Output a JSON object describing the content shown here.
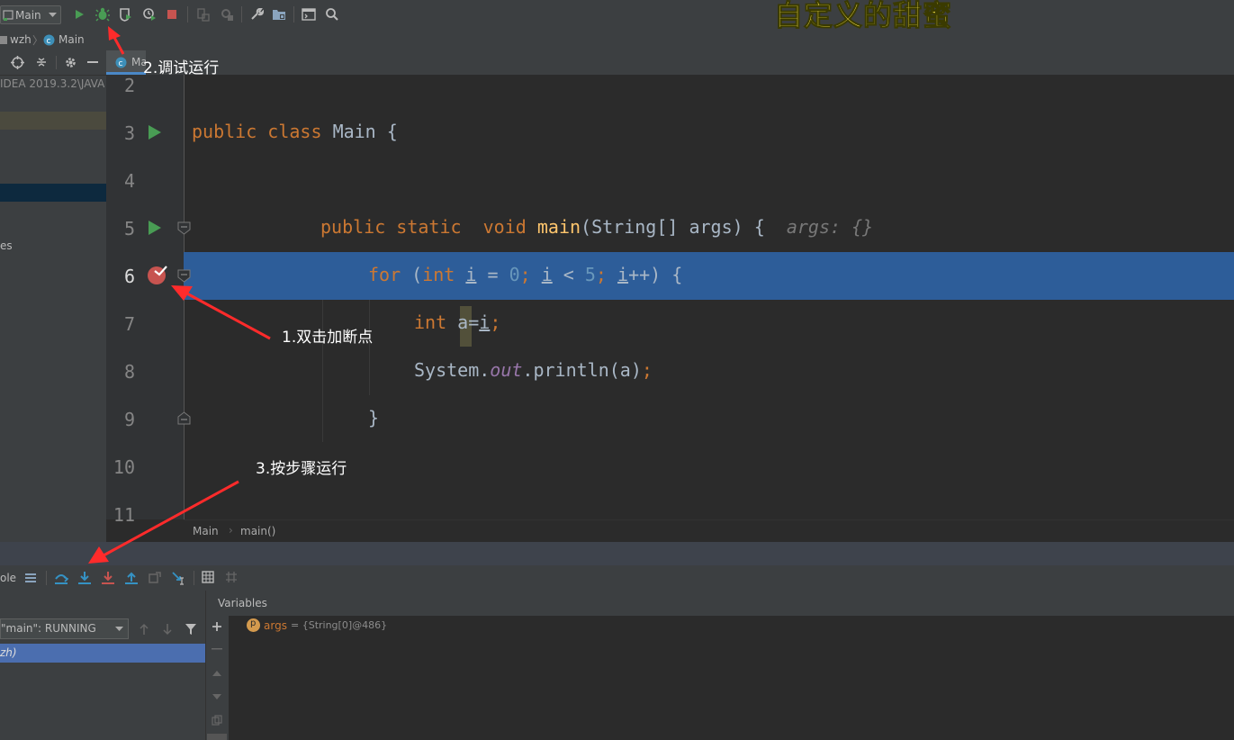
{
  "toolbar": {
    "run_config": "Main",
    "icons": [
      "run-icon",
      "debug-icon",
      "coverage-icon",
      "profile-icon",
      "stop-icon",
      "build-icon",
      "rebuild-icon",
      "settings-wrench-icon",
      "project-structure-icon",
      "terminal-icon",
      "search-icon"
    ]
  },
  "breadcrumb": {
    "project": "wzh",
    "file": "Main"
  },
  "project_panel": {
    "path_text": "IDEA 2019.3.2\\JAVA",
    "partial_item": "es"
  },
  "editor": {
    "tab_label": "Main.java",
    "lines": [
      {
        "num": "2"
      },
      {
        "num": "3"
      },
      {
        "num": "4"
      },
      {
        "num": "5"
      },
      {
        "num": "6"
      },
      {
        "num": "7"
      },
      {
        "num": "8"
      },
      {
        "num": "9"
      },
      {
        "num": "10"
      },
      {
        "num": "11"
      }
    ],
    "code": {
      "l3_public": "public",
      "l3_class": "class",
      "l3_name": "Main",
      "l3_brace": "{",
      "l5_public": "public",
      "l5_static": "static",
      "l5_void": "void",
      "l5_main": "main",
      "l5_params": "(String[] args) {",
      "l5_hint": "args: {}",
      "l6_for": "for",
      "l6_open": "(",
      "l6_int": "int",
      "l6_i1": "i",
      "l6_eq": " = ",
      "l6_zero": "0",
      "l6_semi1": "; ",
      "l6_i2": "i",
      "l6_lt": " < ",
      "l6_five": "5",
      "l6_semi2": "; ",
      "l6_i3": "i",
      "l6_inc": "++) {",
      "l7_int": "int",
      "l7_a": "a",
      "l7_eq": "=",
      "l7_i": "i",
      "l7_semi": ";",
      "l8_sys": "System.",
      "l8_out": "out",
      "l8_print": ".println(a)",
      "l8_semi": ";",
      "l9_close": "}"
    },
    "status_breadcrumb": {
      "class": "Main",
      "method": "main()"
    }
  },
  "debug": {
    "tab_partial": "ole",
    "thread_selector": "\"main\": RUNNING",
    "frame_partial": "zh)",
    "variables_title": "Variables",
    "var_name": "args",
    "var_value": "= {String[0]@486}",
    "var_badge": "p"
  },
  "annotations": {
    "a1": "1.双击加断点",
    "a2": "2.调试运行",
    "a3": "3.按步骤运行",
    "watermark": "自定义的甜蜜"
  },
  "colors": {
    "run_green": "#499c54",
    "stop_red": "#c75450",
    "selection_blue": "#2d5d99",
    "arrow_red": "#ff2b2b"
  }
}
